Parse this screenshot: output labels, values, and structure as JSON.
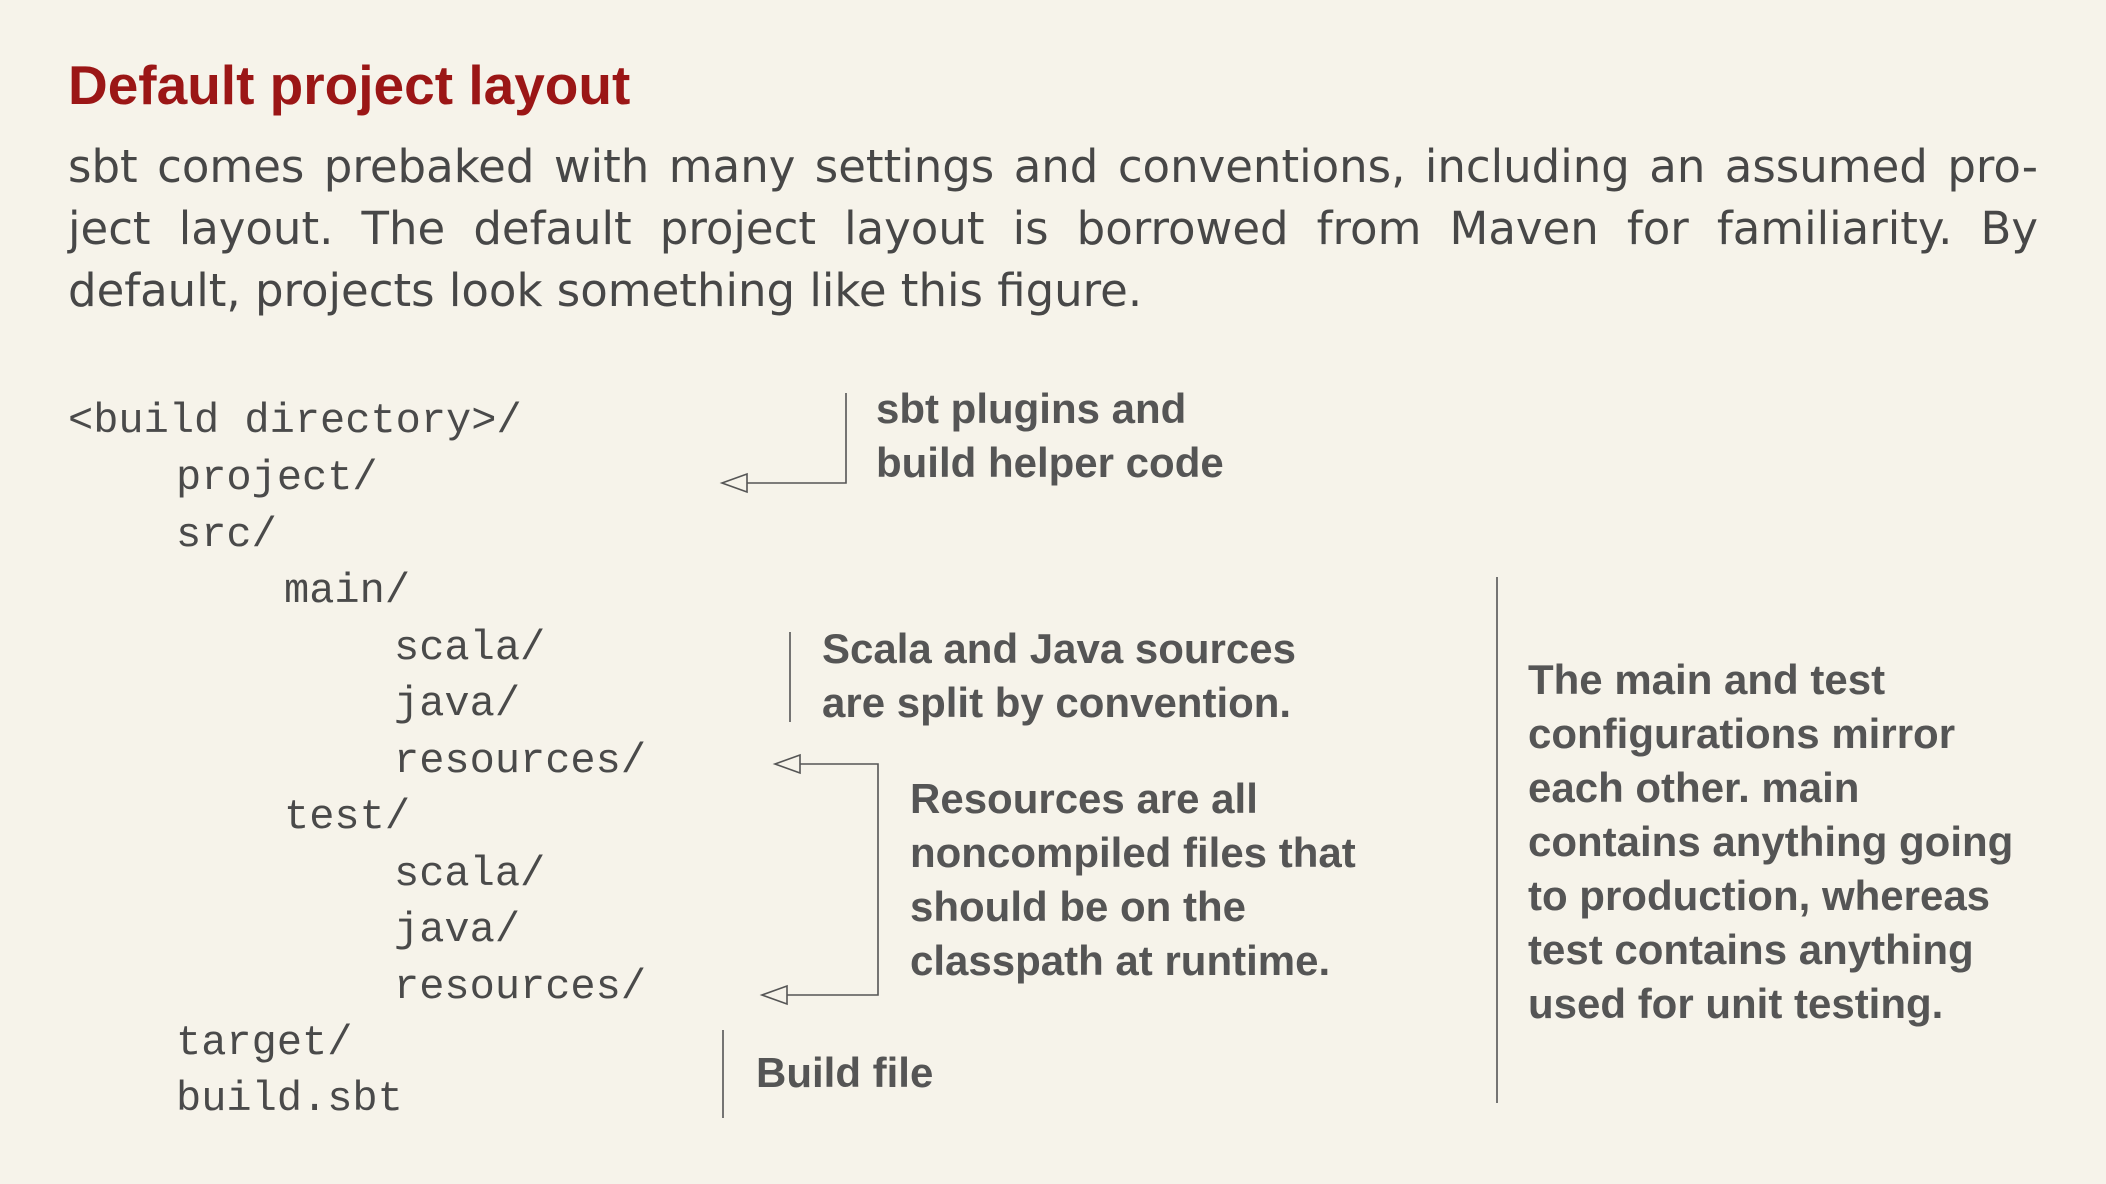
{
  "title": "Default project layout",
  "intro": "sbt comes prebaked with many settings and conventions, including an assumed pro-ject layout. The default project layout is borrowed from Maven for familiarity. By default, projects look something like this figure.",
  "tree": [
    "<build directory>/",
    "project/",
    "src/",
    "main/",
    "scala/",
    "java/",
    "resources/",
    "test/",
    "scala/",
    "java/",
    "resources/",
    "target/",
    "build.sbt"
  ],
  "notes": {
    "plugins": [
      "sbt plugins and",
      "build helper code"
    ],
    "sources": [
      "Scala and Java sources",
      "are split by convention."
    ],
    "resources": [
      "Resources are all",
      "noncompiled files that",
      "should be on the",
      "classpath at runtime."
    ],
    "build_file": [
      "Build file"
    ],
    "mirror": [
      "The main and test",
      "configurations mirror",
      "each other. main",
      "contains anything going",
      "to production, whereas",
      "test contains anything",
      "used for unit testing."
    ]
  }
}
